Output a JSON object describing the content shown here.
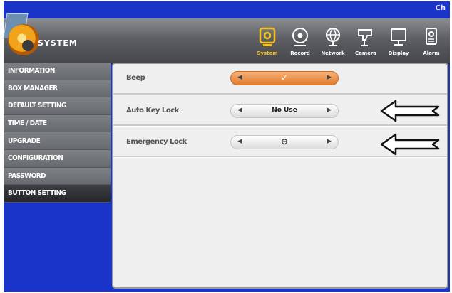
{
  "header": {
    "corner_text": "Ch",
    "title": "SYSTEM"
  },
  "top_icons": [
    {
      "label": "System",
      "icon": "system-icon",
      "active": true
    },
    {
      "label": "Record",
      "icon": "record-icon",
      "active": false
    },
    {
      "label": "Network",
      "icon": "network-icon",
      "active": false
    },
    {
      "label": "Camera",
      "icon": "camera-icon",
      "active": false
    },
    {
      "label": "Display",
      "icon": "display-icon",
      "active": false
    },
    {
      "label": "Alarm",
      "icon": "alarm-icon",
      "active": false
    }
  ],
  "sidebar": {
    "items": [
      {
        "label": "INFORMATION"
      },
      {
        "label": "BOX MANAGER"
      },
      {
        "label": "DEFAULT SETTING"
      },
      {
        "label": "TIME / DATE"
      },
      {
        "label": "UPGRADE"
      },
      {
        "label": "CONFIGURATION"
      },
      {
        "label": "PASSWORD"
      },
      {
        "label": "BUTTON SETTING",
        "selected": true
      }
    ]
  },
  "settings": {
    "beep": {
      "label": "Beep",
      "value": "✓"
    },
    "auto_key_lock": {
      "label": "Auto Key Lock",
      "value": "No Use"
    },
    "emergency_lock": {
      "label": "Emergency Lock",
      "value": "⊖"
    }
  },
  "colors": {
    "accent": "#f5c01a",
    "background": "#1a33c8",
    "selected_selector": "#e07a2e"
  }
}
